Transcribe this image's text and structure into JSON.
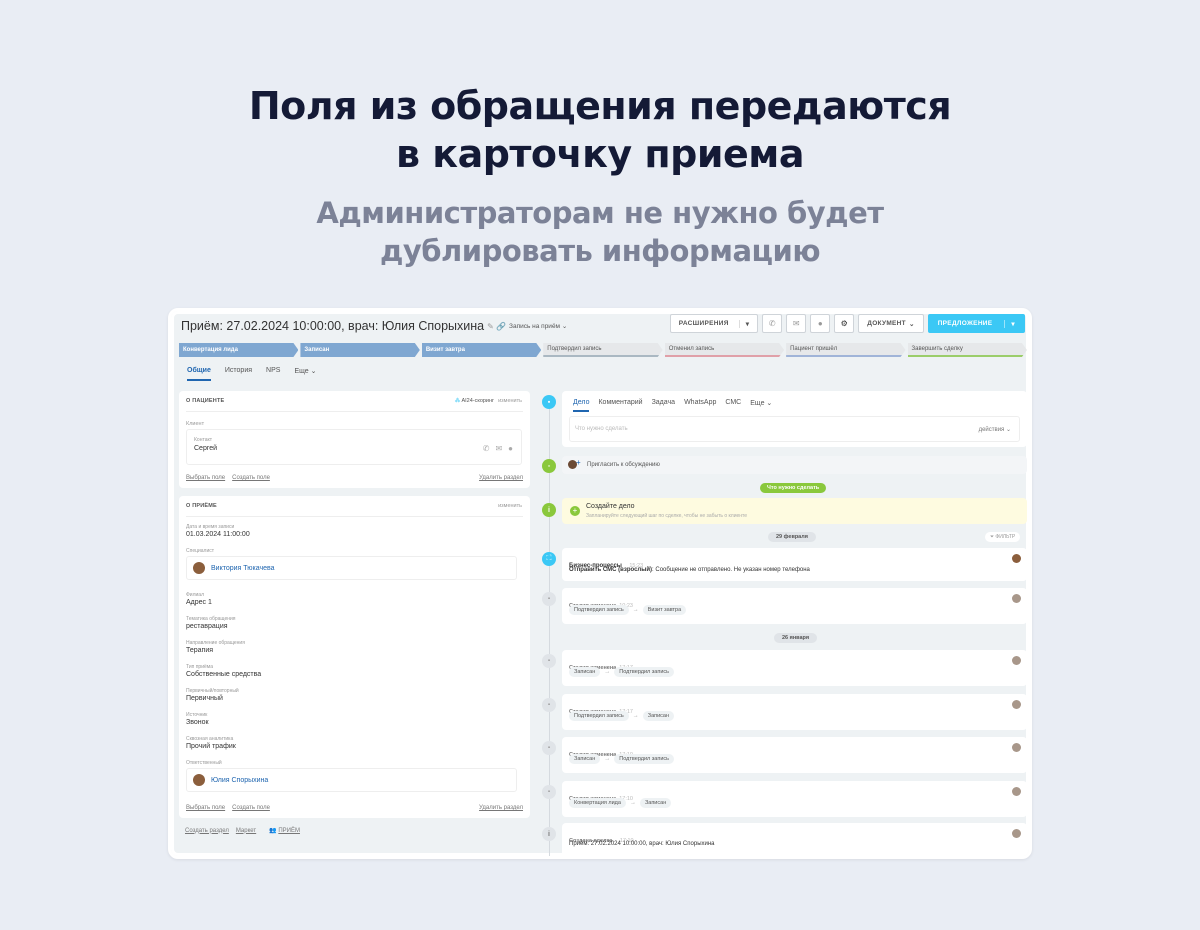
{
  "hero": {
    "line1": "Поля из обращения передаются",
    "line2": "в карточку приема",
    "sub1": "Администраторам не нужно будет",
    "sub2": "дублировать информацию"
  },
  "header": {
    "title": "Приём: 27.02.2024 10:00:00, врач: Юлия Спорыхина",
    "category": "Запись на приём",
    "btn_extensions": "РАСШИРЕНИЯ",
    "btn_document": "ДОКУМЕНТ",
    "btn_offer": "ПРЕДЛОЖЕНИЕ"
  },
  "stages": [
    "Конвертация лида",
    "Записан",
    "Визит завтра",
    "Подтвердил запись",
    "Отменил запись",
    "Пациент пришёл",
    "Завершить сделку"
  ],
  "stage_colors": [
    "#7fa7d1",
    "#7fa7d1",
    "#7fa7d1",
    "#e6e8ea",
    "#e6e8ea",
    "#e6e8ea",
    "#e6e8ea"
  ],
  "tabs": [
    "Общие",
    "История",
    "NPS",
    "Еще"
  ],
  "patient": {
    "section": "О ПАЦИЕНТЕ",
    "ai": "AI24-скоринг",
    "edit": "изменить",
    "client_label": "Клиент",
    "contact_label": "Контакт",
    "contact_name": "Сергей",
    "choose_field": "Выбрать поле",
    "create_field": "Создать поле",
    "delete_section": "Удалить раздел"
  },
  "visit": {
    "section": "О ПРИЁМЕ",
    "edit": "изменить",
    "fields": [
      {
        "label": "Дата и время записи",
        "value": "01.03.2024 11:00:00"
      },
      {
        "label": "Специалист",
        "value": "Виктория Тюкачева",
        "person": true
      },
      {
        "label": "Филиал",
        "value": "Адрес 1"
      },
      {
        "label": "Тематика обращения",
        "value": "реставрация"
      },
      {
        "label": "Направление обращения",
        "value": "Терапия"
      },
      {
        "label": "Тип приёма",
        "value": "Собственные средства"
      },
      {
        "label": "Первичный/повторный",
        "value": "Первичный"
      },
      {
        "label": "Источник",
        "value": "Звонок"
      },
      {
        "label": "Сквозная аналитика",
        "value": "Прочий трафик"
      },
      {
        "label": "Ответственный",
        "value": "Юлия Спорыхина",
        "person": true
      }
    ],
    "choose_field": "Выбрать поле",
    "create_field": "Создать поле",
    "delete_section": "Удалить раздел"
  },
  "footer": {
    "create_section": "Создать раздел",
    "market": "Маркет",
    "visit": "ПРИЁМ"
  },
  "activity": {
    "tabs": [
      "Дело",
      "Комментарий",
      "Задача",
      "WhatsApp",
      "СМС",
      "Еще"
    ],
    "placeholder": "Что нужно сделать",
    "actions": "действия",
    "invite": "Пригласить к обсуждению",
    "todo_badge": "Что нужно сделать",
    "create_task": "Создайте дело",
    "create_task_hint": "Запланируйте следующий шаг по сделке, чтобы не забыть о клиенте",
    "date1": "29 февраля",
    "filter": "ФИЛЬТР",
    "bp_title": "Бизнес-процессы",
    "bp_time": "15:23",
    "bp_text_bold": "Отправить СМС (взрослый)",
    "bp_text": ": Сообщение не отправлено. Не указан номер телефона",
    "date2": "26 января",
    "events": [
      {
        "title": "Стадия изменена",
        "time": "10:23",
        "from": "Подтвердил запись",
        "to": "Визит завтра"
      },
      {
        "title": "Стадия изменена",
        "time": "17:17",
        "from": "Записан",
        "to": "Подтвердил запись"
      },
      {
        "title": "Стадия изменена",
        "time": "17:17",
        "from": "Подтвердил запись",
        "to": "Записан"
      },
      {
        "title": "Стадия изменена",
        "time": "17:10",
        "from": "Записан",
        "to": "Подтвердил запись"
      },
      {
        "title": "Стадия изменена",
        "time": "17:10",
        "from": "Конвертация лида",
        "to": "Записан"
      }
    ],
    "created_title": "Создана сделка",
    "created_time": "17:10",
    "created_text": "Приём: 27.02.2024 10:00:00, врач: Юлия Спорыхина"
  }
}
